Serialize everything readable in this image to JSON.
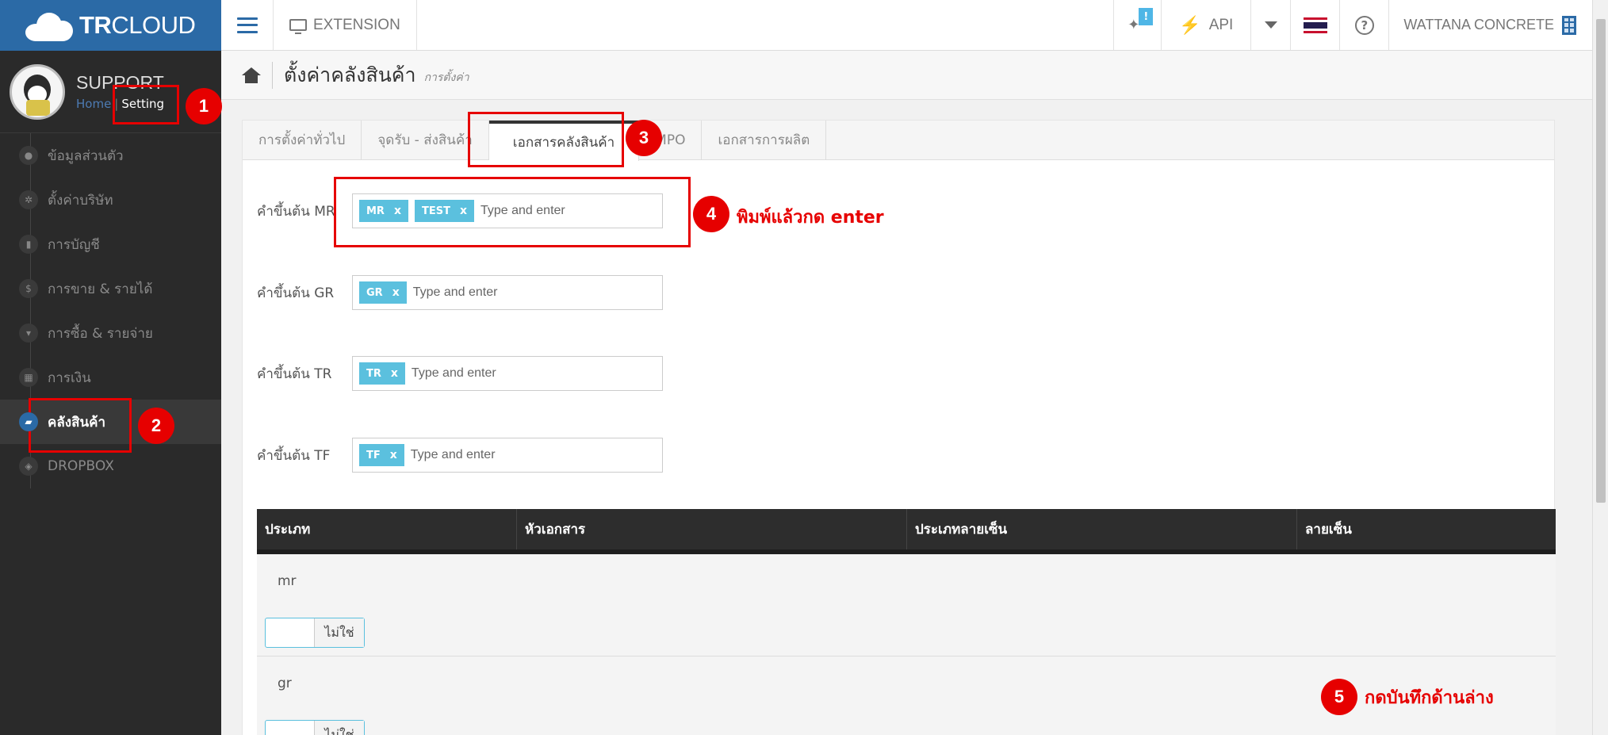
{
  "app": {
    "logo_bold": "TR",
    "logo_rest": "CLOUD"
  },
  "profile": {
    "name": "SUPPORT",
    "home_link": "Home",
    "separator": "|",
    "setting_link": "Setting"
  },
  "sidebar": {
    "items": [
      {
        "label": "ข้อมูลส่วนตัว",
        "icon": "user-icon",
        "glyph": "●"
      },
      {
        "label": "ตั้งค่าบริษัท",
        "icon": "gear-icon",
        "glyph": "✲"
      },
      {
        "label": "การบัญชี",
        "icon": "book-icon",
        "glyph": "▮"
      },
      {
        "label": "การขาย & รายได้",
        "icon": "dollar-icon",
        "glyph": "$"
      },
      {
        "label": "การซื้อ & รายจ่าย",
        "icon": "cart-icon",
        "glyph": "▾"
      },
      {
        "label": "การเงิน",
        "icon": "calendar-icon",
        "glyph": "▦"
      },
      {
        "label": "คลังสินค้า",
        "icon": "warehouse-icon",
        "glyph": "▰",
        "active": true
      },
      {
        "label": "DROPBOX",
        "icon": "dropbox-icon",
        "glyph": "◈"
      }
    ]
  },
  "topbar": {
    "extension_label": "EXTENSION",
    "notif_badge": "!",
    "api_label": "API",
    "help_glyph": "?",
    "company": "WATTANA CONCRETE"
  },
  "page": {
    "title": "ตั้งค่าคลังสินค้า",
    "subtitle": "การตั้งค่า"
  },
  "tabs": [
    "การตั้งค่าทั่วไป",
    "จุดรับ - ส่งสินค้า",
    "เอกสารคลังสินค้า",
    "MPO",
    "เอกสารการผลิต"
  ],
  "active_tab": 2,
  "fields": [
    {
      "label": "คำขึ้นต้น MR",
      "tags": [
        "MR",
        "TEST"
      ],
      "placeholder": "Type and enter"
    },
    {
      "label": "คำขึ้นต้น GR",
      "tags": [
        "GR"
      ],
      "placeholder": "Type and enter"
    },
    {
      "label": "คำขึ้นต้น TR",
      "tags": [
        "TR"
      ],
      "placeholder": "Type and enter"
    },
    {
      "label": "คำขึ้นต้น TF",
      "tags": [
        "TF"
      ],
      "placeholder": "Type and enter"
    }
  ],
  "tag_remove_glyph": "x",
  "table": {
    "headers": [
      "ประเภท",
      "หัวเอกสาร",
      "ประเภทลายเซ็น",
      "ลายเซ็น"
    ],
    "rows": [
      {
        "type": "mr",
        "toggle_label": "ไม่ใช่"
      },
      {
        "type": "gr",
        "toggle_label": "ไม่ใช่"
      }
    ]
  },
  "annotations": {
    "steps": [
      "1",
      "2",
      "3",
      "4",
      "5"
    ],
    "note_4": "พิมพ์แล้วกด enter",
    "note_5": "กดบันทึกด้านล่าง",
    "color": "#e60000"
  },
  "colors": {
    "brand": "#2b6aa6",
    "tag": "#5bc0de",
    "sidebar": "#2a2a2a"
  }
}
